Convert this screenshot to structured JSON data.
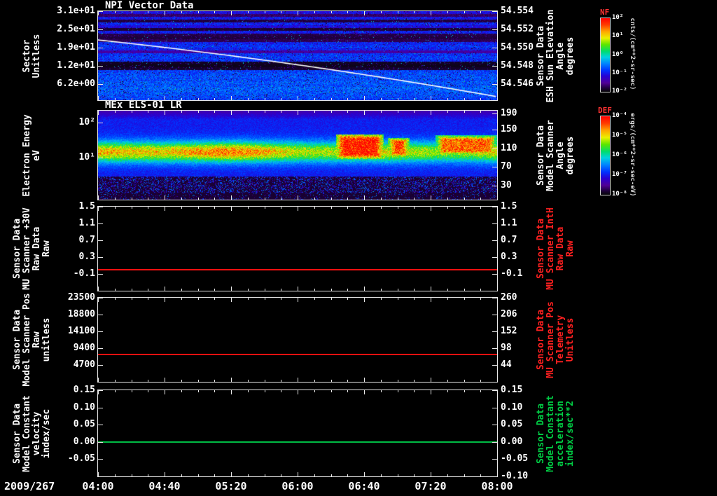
{
  "chart_data": {
    "type": "heatmap",
    "description": "Stacked time-series plot: two spectrogram panels (NPI sector counts, MEx ELS-01 LR electron energy flux) and three constant-value line panels, versus time on 2009/267 from 04:00 to 08:00.",
    "x_axis": {
      "date_label": "2009/267",
      "ticks": [
        "04:00",
        "04:40",
        "05:20",
        "06:00",
        "06:40",
        "07:20",
        "08:00"
      ]
    },
    "panels": [
      {
        "title": "NPI Vector Data",
        "type": "spectrogram",
        "left_label_lines": [
          "Sector",
          "Unitless"
        ],
        "left_ticks": [
          {
            "label": "3.1e+01",
            "frac": 0.0
          },
          {
            "label": "2.5e+01",
            "frac": 0.205
          },
          {
            "label": "1.9e+01",
            "frac": 0.41
          },
          {
            "label": "1.2e+01",
            "frac": 0.615
          },
          {
            "label": "6.2e+00",
            "frac": 0.82
          }
        ],
        "right_label_lines": [
          "Sensor Data",
          "ESH Sun Elevation",
          "Angle",
          "degrees"
        ],
        "right_ticks": [
          {
            "label": "54.554",
            "frac": 0.0
          },
          {
            "label": "54.552",
            "frac": 0.205
          },
          {
            "label": "54.550",
            "frac": 0.41
          },
          {
            "label": "54.548",
            "frac": 0.615
          },
          {
            "label": "54.546",
            "frac": 0.82
          }
        ],
        "overlay_line": {
          "name": "ESH Sun Elevation Angle",
          "color": "#ffffff",
          "start_value": 54.552,
          "end_value": 54.545,
          "shape": "smooth monotonically descending curve across the panel"
        },
        "spectrogram": {
          "colorbar": "NF",
          "description": "32 azimuthal sectors; mostly blue low counts, dark/black bands near sector 21-23 and 11-13, purple speckle noise, brighter smooth blue in lowest sectors",
          "row_levels": [
            0.24,
            0.1,
            0.26,
            0.06,
            0.28,
            0.24,
            0.05,
            0.27,
            0.07,
            0.06,
            0.08,
            0.28,
            0.3,
            0.28,
            0.16,
            0.3,
            0.31,
            0.3,
            0.03,
            0.02,
            0.04,
            0.32,
            0.33,
            0.34,
            0.33,
            0.35,
            0.34,
            0.36,
            0.35,
            0.34,
            0.33,
            0.32
          ]
        }
      },
      {
        "title": "MEx ELS-01 LR",
        "type": "spectrogram",
        "left_label_lines": [
          "Electron Energy",
          "eV"
        ],
        "left_ticks": [
          {
            "label": "10²",
            "frac": 0.13
          },
          {
            "label": "10¹",
            "frac": 0.53
          }
        ],
        "right_label_lines": [
          "Sensor Data",
          "Model Scanner",
          "Angle",
          "degrees"
        ],
        "right_ticks": [
          {
            "label": "190",
            "frac": 0.03
          },
          {
            "label": "150",
            "frac": 0.21
          },
          {
            "label": "110",
            "frac": 0.425
          },
          {
            "label": "70",
            "frac": 0.63
          },
          {
            "label": "30",
            "frac": 0.84
          }
        ],
        "spectrogram": {
          "colorbar": "DEF",
          "band_center_frac": 0.46,
          "description": "Yellow-green electron flux band near 10-30 eV across whole interval, blue above/below, dark speckled background at lowest energies; intense red enhancements ~06:20-06:55, ~07:00-07:10 and ~07:35-08:00",
          "red_blobs": [
            {
              "t0": 0.595,
              "t1": 0.715,
              "f0": 0.26,
              "f1": 0.54,
              "v": 0.97
            },
            {
              "t0": 0.725,
              "t1": 0.78,
              "f0": 0.3,
              "f1": 0.52,
              "v": 0.93
            },
            {
              "t0": 0.845,
              "t1": 1.0,
              "f0": 0.27,
              "f1": 0.5,
              "v": 0.88
            }
          ]
        }
      },
      {
        "type": "line",
        "left_label_lines": [
          "Sensor Data",
          "MU Scanner +30V",
          "Raw Data",
          "Raw"
        ],
        "left_ticks": [
          {
            "label": "1.5",
            "frac": 0.0
          },
          {
            "label": "1.1",
            "frac": 0.2
          },
          {
            "label": "0.7",
            "frac": 0.4
          },
          {
            "label": "0.3",
            "frac": 0.6
          },
          {
            "label": "-0.1",
            "frac": 0.8
          }
        ],
        "right_label_lines": [
          "Sensor Data",
          "MU Scanner IntH",
          "Raw Data",
          "Raw"
        ],
        "right_label_color": "#ff2020",
        "right_ticks": [
          {
            "label": "1.5",
            "frac": 0.0
          },
          {
            "label": "1.1",
            "frac": 0.2
          },
          {
            "label": "0.7",
            "frac": 0.4
          },
          {
            "label": "0.3",
            "frac": 0.6
          },
          {
            "label": "-0.1",
            "frac": 0.8
          }
        ],
        "series": {
          "name": "MU Scanner +30V Raw",
          "value": 0.0,
          "yrange": [
            1.5,
            -0.5
          ],
          "color": "#ff1010"
        }
      },
      {
        "type": "line",
        "left_label_lines": [
          "Sensor Data",
          "Model Scanner Pos",
          "Raw",
          "unitless"
        ],
        "left_ticks": [
          {
            "label": "23500",
            "frac": 0.0
          },
          {
            "label": "18800",
            "frac": 0.2
          },
          {
            "label": "14100",
            "frac": 0.4
          },
          {
            "label": "9400",
            "frac": 0.6
          },
          {
            "label": "4700",
            "frac": 0.8
          }
        ],
        "right_label_lines": [
          "Sensor Data",
          "MU Scanner Pos",
          "Telemetry",
          "Unitless"
        ],
        "right_label_color": "#ff2020",
        "right_ticks": [
          {
            "label": "260",
            "frac": 0.0
          },
          {
            "label": "206",
            "frac": 0.2
          },
          {
            "label": "152",
            "frac": 0.4
          },
          {
            "label": "98",
            "frac": 0.6
          },
          {
            "label": "44",
            "frac": 0.8
          }
        ],
        "series": {
          "name": "Model Scanner Pos Raw",
          "value": 7600,
          "yrange": [
            23500,
            0
          ],
          "color": "#ff1010"
        }
      },
      {
        "type": "line",
        "left_label_lines": [
          "Sensor Data",
          "Model Constant",
          "velocity",
          "index/sec"
        ],
        "left_ticks": [
          {
            "label": "0.15",
            "frac": 0.0
          },
          {
            "label": "0.10",
            "frac": 0.2
          },
          {
            "label": "0.05",
            "frac": 0.4
          },
          {
            "label": "0.00",
            "frac": 0.6
          },
          {
            "label": "-0.05",
            "frac": 0.8
          }
        ],
        "right_label_lines": [
          "Sensor Data",
          "Model Constant",
          "acceleration",
          "index/sec**2"
        ],
        "right_label_color": "#00cc44",
        "right_ticks": [
          {
            "label": "0.15",
            "frac": 0.0
          },
          {
            "label": "0.10",
            "frac": 0.2
          },
          {
            "label": "0.05",
            "frac": 0.4
          },
          {
            "label": "0.00",
            "frac": 0.6
          },
          {
            "label": "-0.05",
            "frac": 0.8
          },
          {
            "label": "-0.10",
            "frac": 1.0
          }
        ],
        "series": {
          "name": "Model Constant velocity",
          "value": 0.0,
          "yrange": [
            0.15,
            -0.1
          ],
          "color": "#00bb44"
        }
      }
    ],
    "colorbars": [
      {
        "label": "NF",
        "ticks": [
          "10²",
          "10¹",
          "10⁰",
          "10⁻¹",
          "10⁻²"
        ],
        "units": "cnts/(cm**2-sr-sec)"
      },
      {
        "label": "DEF",
        "ticks": [
          "10⁻⁴",
          "10⁻⁵",
          "10⁻⁶",
          "10⁻⁷",
          "10⁻⁸"
        ],
        "units": "ergs/(cm**2-sr-sec-eV)"
      }
    ]
  }
}
